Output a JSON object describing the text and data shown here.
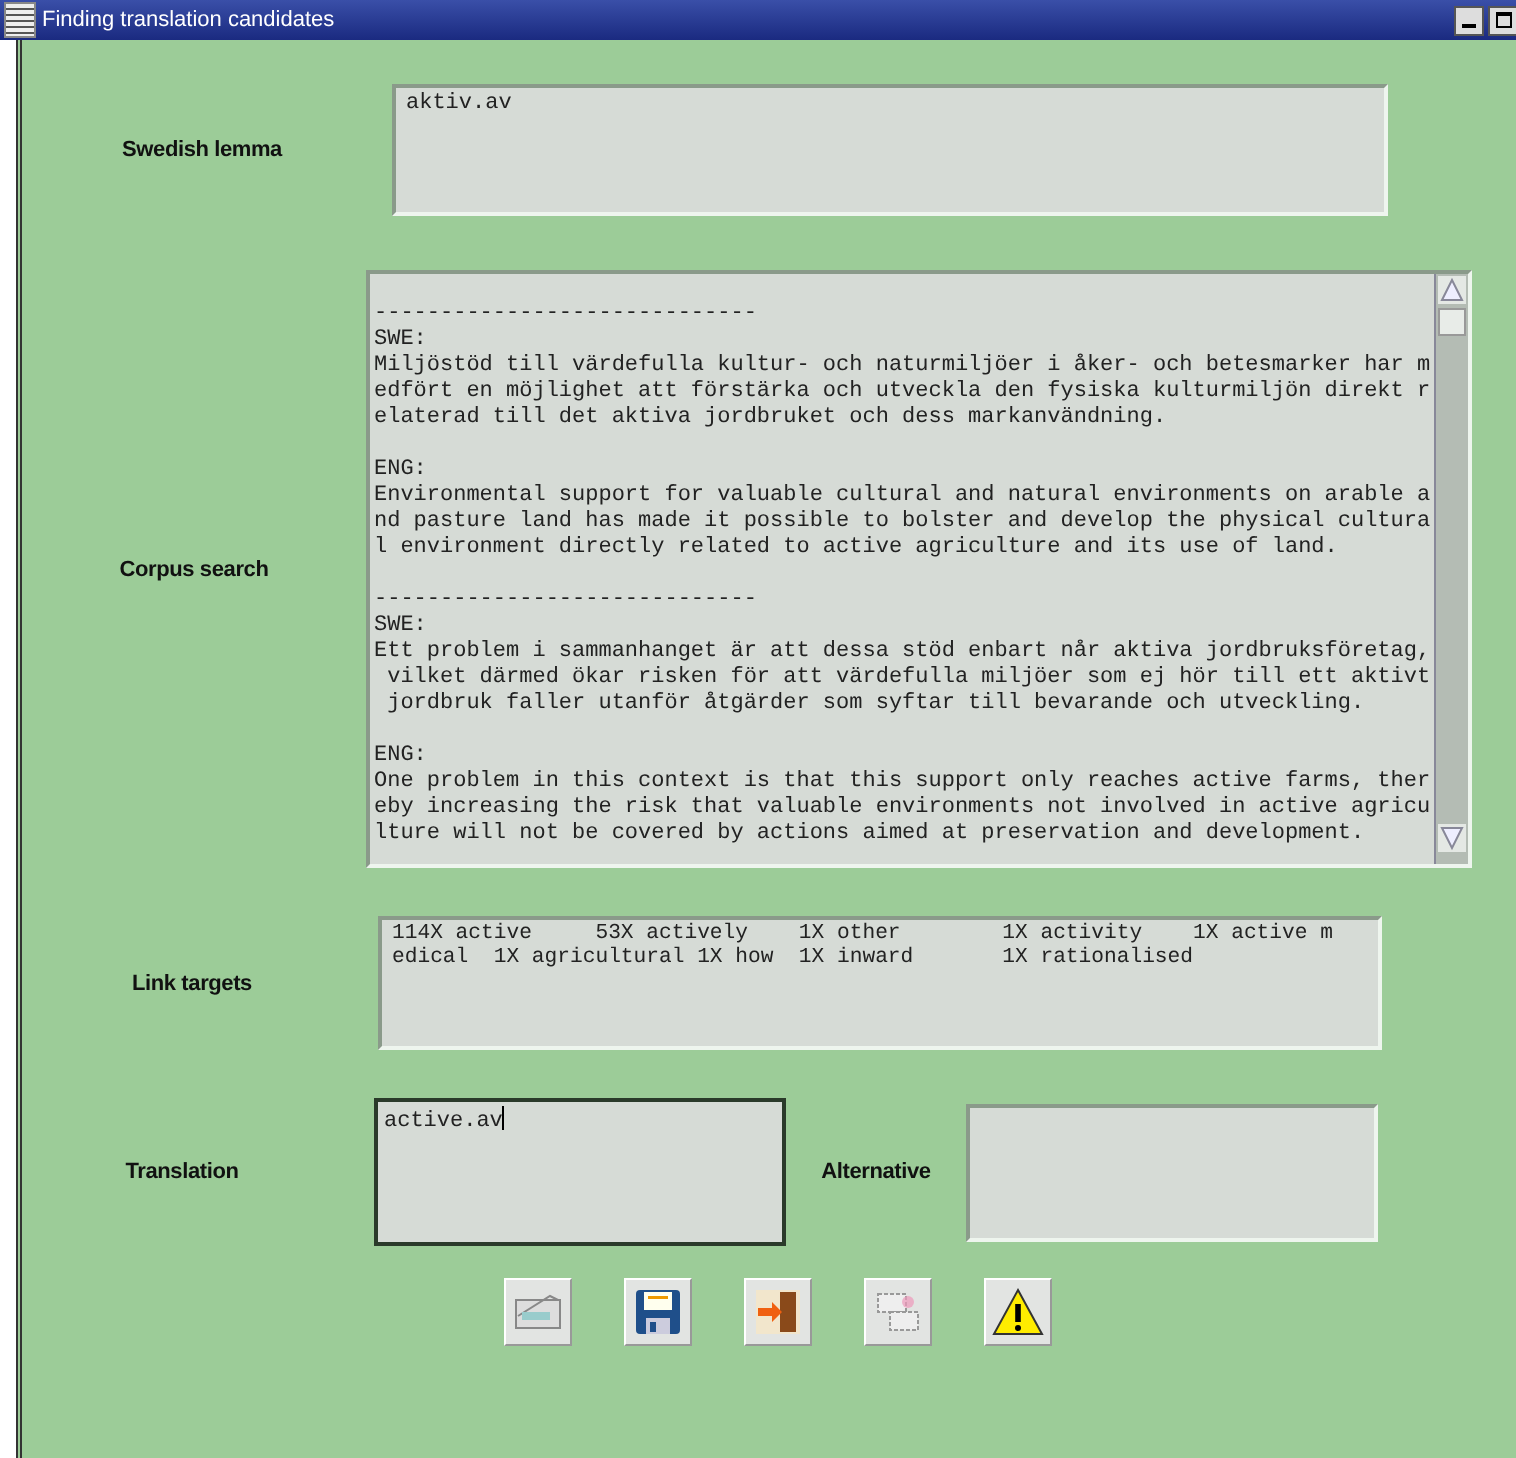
{
  "window": {
    "title": "Finding translation candidates"
  },
  "swedish_lemma": {
    "label": "Swedish lemma",
    "value": "aktiv.av"
  },
  "corpus_search": {
    "label": "Corpus search",
    "blocks": [
      {
        "kind": "rule",
        "text": "-----------------------------"
      },
      {
        "kind": "tag",
        "text": "SWE:"
      },
      {
        "kind": "para",
        "lines": [
          "Miljöstöd till värdefulla kultur- och naturmiljöer i åker- och betesmarker har m",
          "edfört en möjlighet att förstärka och utveckla den fysiska kulturmiljön direkt r",
          "elaterad till det aktiva jordbruket och dess markanvändning."
        ]
      },
      {
        "kind": "tag",
        "text": "ENG:"
      },
      {
        "kind": "para",
        "lines": [
          "Environmental support for valuable cultural and natural environments on arable a",
          "nd pasture land has made it possible to bolster and develop the physical cultura",
          "l environment directly related to active agriculture and its use of land."
        ]
      },
      {
        "kind": "rule",
        "text": "-----------------------------"
      },
      {
        "kind": "tag",
        "text": "SWE:"
      },
      {
        "kind": "para",
        "lines": [
          "Ett problem i sammanhanget är att dessa stöd enbart når aktiva jordbruksföretag,",
          " vilket därmed ökar risken för att värdefulla miljöer som ej hör till ett aktivt",
          " jordbruk faller utanför åtgärder som syftar till bevarande och utveckling."
        ]
      },
      {
        "kind": "tag",
        "text": "ENG:"
      },
      {
        "kind": "para",
        "lines": [
          "One problem in this context is that this support only reaches active farms, ther",
          "eby increasing the risk that valuable environments not involved in active agricu",
          "lture will not be covered by actions aimed at preservation and development."
        ]
      }
    ]
  },
  "link_targets": {
    "label": "Link targets",
    "lines": [
      "114X active     53X actively    1X other        1X activity    1X active m",
      "edical  1X agricultural 1X how  1X inward       1X rationalised"
    ]
  },
  "translation": {
    "label": "Translation",
    "value": "active.av"
  },
  "alternative": {
    "label": "Alternative"
  },
  "toolbar": [
    {
      "kind": "scanner"
    },
    {
      "kind": "save"
    },
    {
      "kind": "exit"
    },
    {
      "kind": "copy"
    },
    {
      "kind": "warning"
    }
  ]
}
